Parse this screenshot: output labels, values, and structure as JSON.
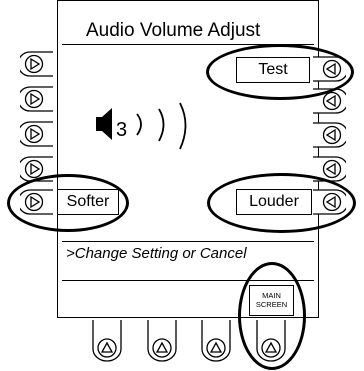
{
  "screen": {
    "title": "Audio Volume Adjust",
    "message": ">Change Setting or Cancel",
    "volume_level": "3"
  },
  "softkeys": {
    "test": "Test",
    "softer": "Softer",
    "louder": "Louder"
  },
  "main_screen_button": {
    "line1": "MAIN",
    "line2": "SCREEN"
  },
  "icons": {
    "left_side_buttons": "triangle-right-icon",
    "right_side_buttons": "triangle-left-icon",
    "bottom_buttons": "triangle-up-icon",
    "volume": "speaker-icon"
  }
}
